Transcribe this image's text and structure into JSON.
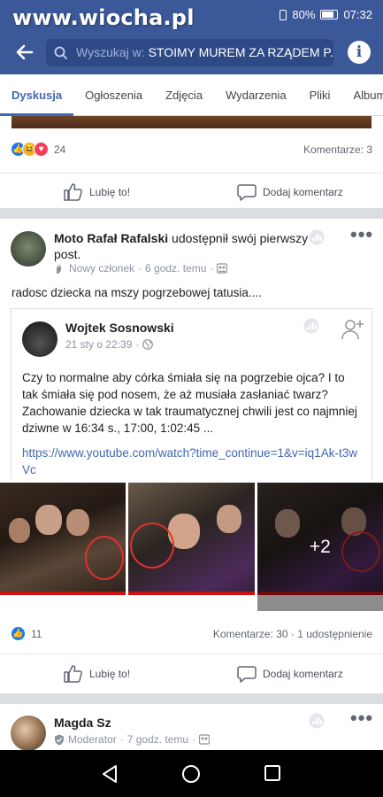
{
  "status_bar": {
    "watermark": "www.wiocha.pl",
    "battery": "80%",
    "time": "07:32"
  },
  "header": {
    "search_prefix": "Wyszukaj w:",
    "search_group": "STOIMY MUREM ZA RZĄDEM P..."
  },
  "tabs": [
    "Dyskusja",
    "Ogłoszenia",
    "Zdjęcia",
    "Wydarzenia",
    "Pliki",
    "Albumy"
  ],
  "prev_post": {
    "reaction_count": "24",
    "comments": "Komentarze: 3",
    "like_label": "Lubię to!",
    "comment_label": "Dodaj komentarz"
  },
  "post": {
    "author": "Moto Rafał Rafalski",
    "action": " udostępnił swój pierwszy post.",
    "badge": "Nowy członek",
    "time": "6 godz. temu",
    "text": "radosc dziecka na mszy pogrzebowej  tatusia....",
    "shared": {
      "author": "Wojtek Sosnowski",
      "time": "21 sty o 22:39",
      "text": "Czy to normalne aby córka śmiała się na pogrzebie ojca? I to tak śmiała się pod nosem, że aż musiała zasłaniać twarz? Zachowanie dziecka w tak traumatycznej chwili jest co najmniej dziwne w 16:34 s., 17:00,  1:02:45 ...",
      "link": "https://www.youtube.com/watch?time_continue=1&v=iq1Ak-t3wVc"
    },
    "photos_extra": "+2",
    "like_count": "11",
    "comments": "Komentarze: 30",
    "shares": "1 udostępnienie",
    "like_label": "Lubię to!",
    "comment_label": "Dodaj komentarz"
  },
  "next_post": {
    "author": "Magda Sz",
    "badge": "Moderator",
    "time": "7 godz. temu"
  },
  "colors": {
    "brand": "#3b5998",
    "link": "#4267b2",
    "like": "#1877f2"
  }
}
